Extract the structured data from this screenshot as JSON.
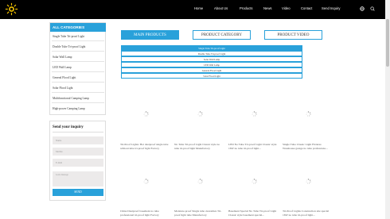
{
  "header": {
    "nav": [
      "Home",
      "About Us",
      "Products",
      "News",
      "Video",
      "Contact",
      "Send Inquiry"
    ],
    "icons": [
      "globe-icon",
      "search-icon"
    ],
    "colors": {
      "background": "#000000",
      "logo": "#f2c200"
    }
  },
  "sidebar": {
    "categories_title": "ALL CATEGORIES",
    "categories": [
      "Single Tube Tri-proof Light",
      "Double Tube Tri-proof Light",
      "Solar Wall Lamp",
      "LED Wall Lamp",
      "General Flood Light",
      "Solar Flood Light",
      "Multifunctional Camping Lamp",
      "High-power Camping Lamp"
    ],
    "inquiry": {
      "title": "Send your inquiry",
      "name_placeholder": "Name",
      "mobile_placeholder": "Mobile",
      "email_placeholder": "E-mail",
      "message_placeholder": "Leave message",
      "send_label": "SEND"
    }
  },
  "main": {
    "tabs": [
      "MAIN PRODUCTS",
      "PRODUCT CATEGORY",
      "PRODUCT VIDEO"
    ],
    "sub_items": [
      "Single Tube Tri-proof Light",
      "Double Tube Tri-proof Light",
      "Solar Wall Lamp",
      "LED Wall Lamp",
      "General Flood Light",
      "Solar Flood Light"
    ],
    "products_row1": [
      "Tri-Proof Lights: Hot dustproof single tube without tube tri-proof light Factory",
      "No Tube Tri-proof Light Classic style no tube tri-proof light Manufactory",
      "LED No Tube Tri-proof Light Classic style 16W no tube tri-proof light...",
      "Single Tube Classic Light Fixtures Warehouse garage no tube professiona..."
    ],
    "products_row2": [
      "China Dustproof basement no tube professional tri-proof light Factory",
      "Moisture-proof Single tube customize Tri-proof light tube Manufactory",
      "Basement Special No Tube Tri-proof Light Classic style basement special...",
      "Tri-Proof Lights Construction site special 16W no tube tri-proof light..."
    ],
    "accent_color": "#29a1da"
  }
}
